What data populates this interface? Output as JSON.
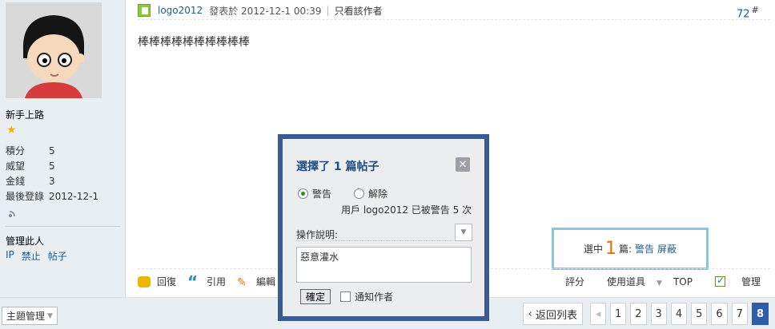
{
  "sidebar": {
    "user_title": "新手上路",
    "stats": [
      {
        "label": "積分",
        "value": "5"
      },
      {
        "label": "威望",
        "value": "5"
      },
      {
        "label": "金錢",
        "value": "3"
      },
      {
        "label": "最後登錄",
        "value": "2012-12-1"
      }
    ],
    "manage_title": "管理此人",
    "manage_links": [
      "IP",
      "禁止",
      "帖子"
    ]
  },
  "post": {
    "author": "logo2012",
    "posted_at": "發表於 2012-12-1 00:39",
    "separator": "|",
    "only_author": "只看該作者",
    "floor": "72",
    "floor_suffix": "#",
    "content": "棒棒棒棒棒棒棒棒棒棒",
    "actions": [
      "回復",
      "引用",
      "編輯"
    ],
    "right_actions": {
      "rate": "評分",
      "tools": "使用道具",
      "top": "TOP",
      "manage": "管理"
    }
  },
  "selection": {
    "prefix": "選中",
    "count": "1",
    "suffix": "篇:",
    "warn_link": "警告",
    "block_link": "屏蔽"
  },
  "modal": {
    "title": "選擇了 1 篇帖子",
    "options": [
      {
        "label": "警告",
        "selected": true
      },
      {
        "label": "解除",
        "selected": false
      }
    ],
    "warn_count": "用戶 logo2012 已被警告 5 次",
    "desc_label": "操作說明:",
    "desc_value": "惡意灌水",
    "confirm": "確定",
    "notify": "通知作者"
  },
  "footer": {
    "thread_manage": "主題管理",
    "back": "返回列表",
    "pages": [
      "1",
      "2",
      "3",
      "4",
      "5",
      "6",
      "7",
      "8"
    ],
    "current_page": "8"
  },
  "colors": {
    "accent": "#2c5eab",
    "modal_border": "#3a5a93",
    "link": "#1c5c8c",
    "highlight": "#f26c00"
  }
}
